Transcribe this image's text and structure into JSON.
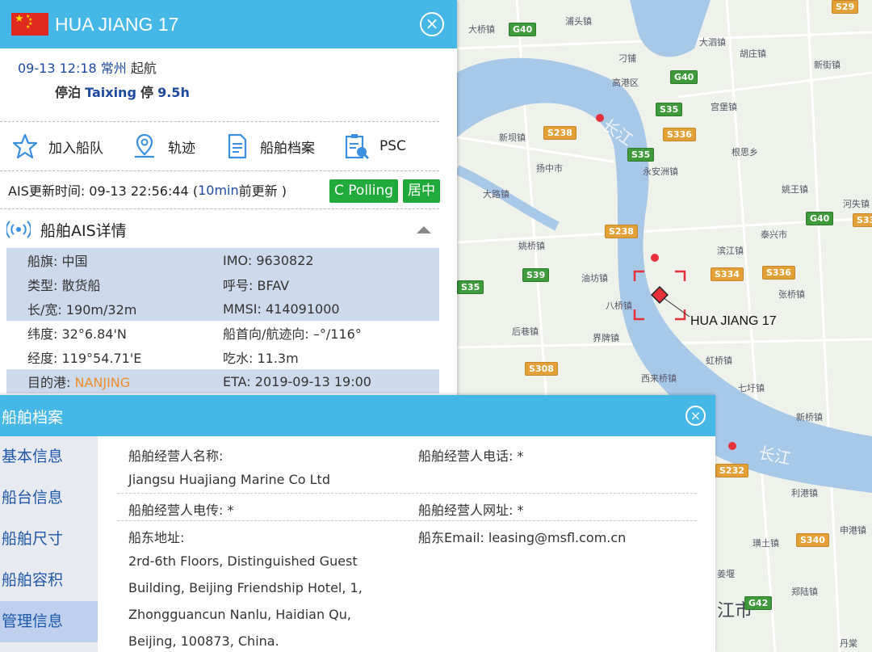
{
  "map": {
    "places": [
      "浦头镇",
      "大桥镇",
      "大泗镇",
      "胡庄镇",
      "新街镇",
      "刁铺",
      "高港区",
      "宫堡镇",
      "新坝镇",
      "扬中市",
      "永安洲镇",
      "根思乡",
      "大路镇",
      "姚王镇",
      "河失镇",
      "泰兴市",
      "姚桥镇",
      "滨江镇",
      "油坊镇",
      "张桥镇",
      "八桥镇",
      "后巷镇",
      "界牌镇",
      "虹桥镇",
      "七圩镇",
      "西来桥镇",
      "新桥镇",
      "利港镇",
      "申港镇",
      "璜土镇",
      "郑陆镇",
      "江市",
      "丹棠",
      "姜堰"
    ],
    "roads": [
      "S29",
      "G40",
      "G40",
      "S35",
      "S238",
      "S336",
      "S35",
      "G40",
      "S33",
      "S238",
      "S39",
      "S334",
      "S336",
      "S35",
      "S308",
      "S232",
      "S340",
      "G42"
    ],
    "river_labels": [
      "长江",
      "长江"
    ],
    "ship_label": "HUA JIANG 17",
    "water_color": "#a8c8e8",
    "land_color": "#eef2ea"
  },
  "ship": {
    "name": "HUA JIANG 17",
    "flag_icon": "china-flag-icon",
    "close_icon": "close-circle-icon",
    "voyage": {
      "datetime": "09-13 12:18",
      "port": "常州",
      "event": "起航",
      "berth_label": "停泊",
      "berth_place": "Taixing",
      "stay_label": "停",
      "stay_time": "9.5h"
    },
    "actions": [
      {
        "label": "加入船队",
        "icon": "star-icon"
      },
      {
        "label": "轨迹",
        "icon": "location-pin-icon"
      },
      {
        "label": "船舶档案",
        "icon": "document-icon"
      },
      {
        "label": "PSC",
        "icon": "clipboard-search-icon"
      }
    ],
    "ais_update": {
      "prefix": "AIS更新时间: 09-13 22:56:44 (",
      "ago": "10min",
      "suffix": " 前更新 )",
      "polling_button": "C Polling",
      "center_button": "居中"
    },
    "section_title": "船舶AIS详情",
    "details": [
      [
        "船旗: 中国",
        "IMO: 9630822"
      ],
      [
        "类型: 散货船",
        "呼号: BFAV"
      ],
      [
        "长/宽: 190m/32m",
        "MMSI: 414091000"
      ],
      [
        "纬度: 32°6.84'N",
        "船首向/航迹向: –°/116°"
      ],
      [
        "经度: 119°54.71'E",
        "吃水: 11.3m"
      ]
    ],
    "destination_label": "目的港: ",
    "destination": "NANJING",
    "eta": "ETA: 2019-09-13 19:00"
  },
  "archive": {
    "title": "船舶档案",
    "nav": [
      "基本信息",
      "船台信息",
      "船舶尺寸",
      "船舶容积",
      "管理信息"
    ],
    "active_nav": "管理信息",
    "fields": {
      "operator_name_label": "船舶经营人名称:",
      "operator_name": "Jiangsu Huajiang Marine Co Ltd",
      "operator_phone": "船舶经营人电话: *",
      "operator_fax": "船舶经营人电传: *",
      "operator_website": "船舶经营人网址: *",
      "owner_address_label": "船东地址:",
      "owner_address_lines": [
        "2rd-6th Floors, Distinguished Guest",
        "Building, Beijing Friendship Hotel, 1,",
        "Zhongguancun Nanlu, Haidian Qu,",
        "Beijing, 100873, China."
      ],
      "owner_email": "船东Email: leasing@msfl.com.cn"
    }
  }
}
